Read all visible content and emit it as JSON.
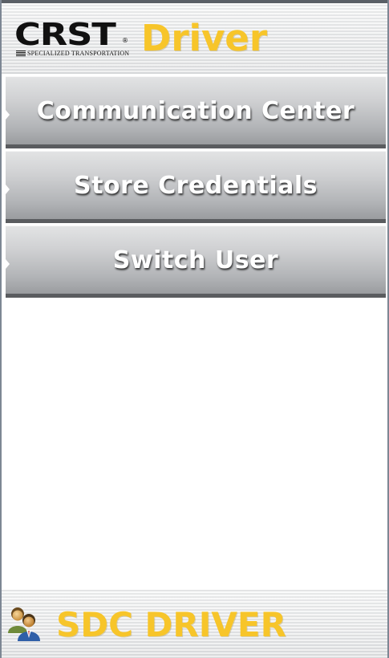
{
  "header": {
    "logo_text": "CRST",
    "logo_reg": "®",
    "logo_subtitle": "SPECIALIZED TRANSPORTATION",
    "title": "Driver",
    "title_color": "#f7c52a"
  },
  "menu": {
    "items": [
      {
        "label": "Communication Center"
      },
      {
        "label": "Store Credentials"
      },
      {
        "label": "Switch User"
      }
    ]
  },
  "footer": {
    "icon": "users-icon",
    "title": "SDC DRIVER"
  }
}
